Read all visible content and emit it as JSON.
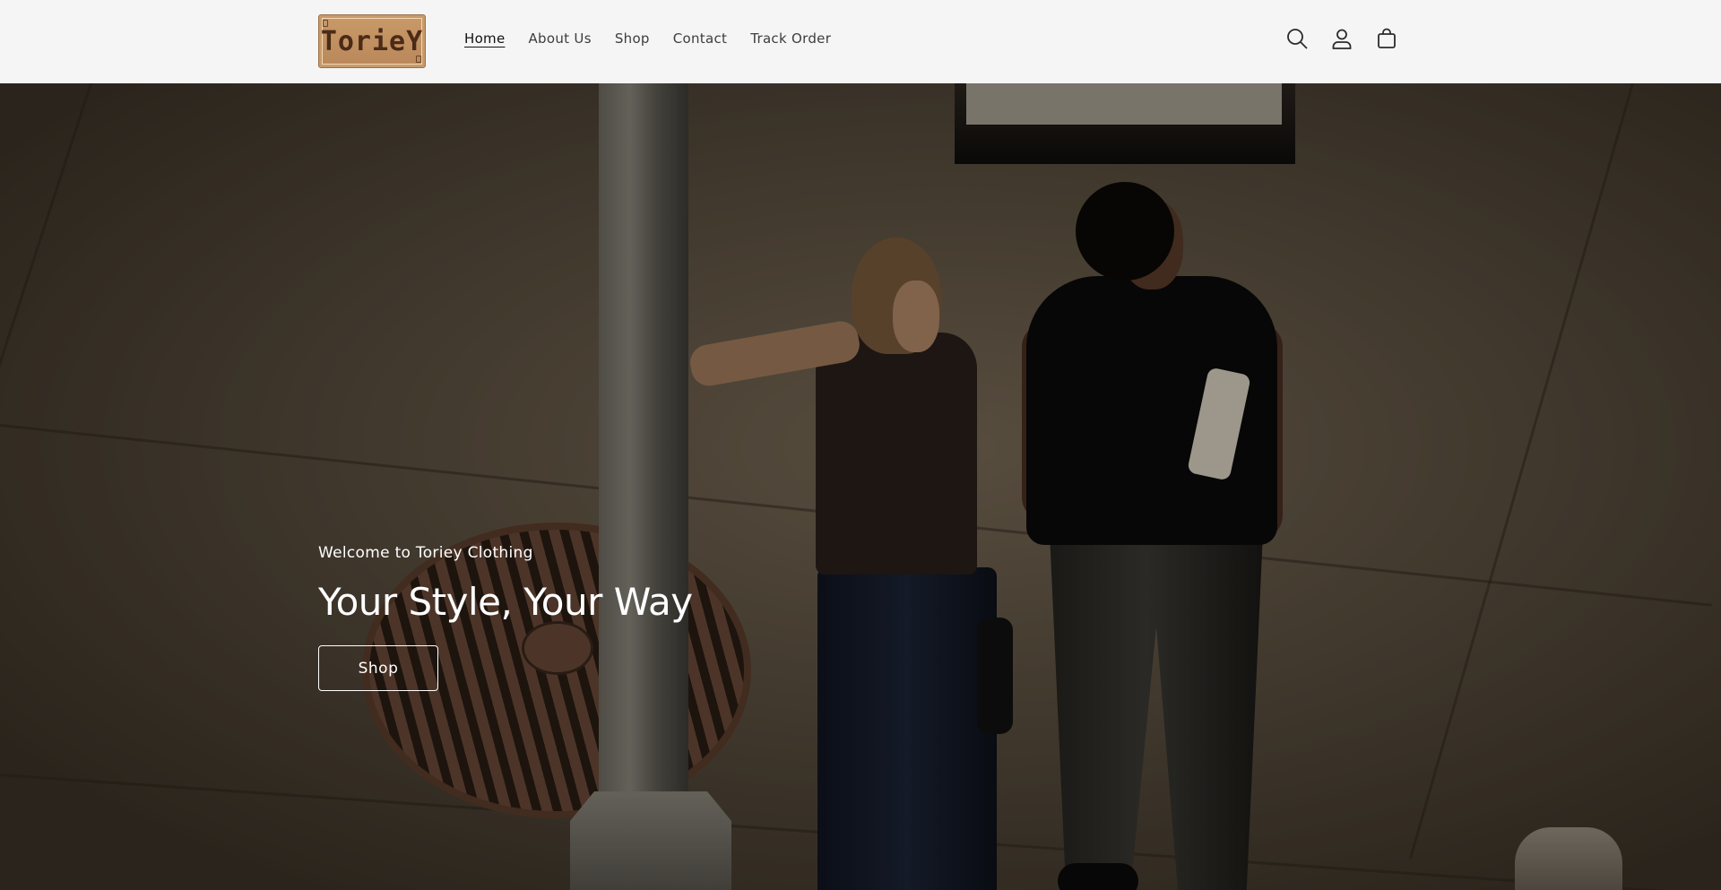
{
  "header": {
    "logo_text": "TorieY",
    "nav": [
      {
        "label": "Home",
        "active": true
      },
      {
        "label": "About Us",
        "active": false
      },
      {
        "label": "Shop",
        "active": false
      },
      {
        "label": "Contact",
        "active": false
      },
      {
        "label": "Track Order",
        "active": false
      }
    ],
    "icons": [
      "search-icon",
      "account-icon",
      "cart-icon"
    ]
  },
  "hero": {
    "subtitle": "Welcome to Toriey Clothing",
    "title": "Your Style, Your Way",
    "button_label": "Shop"
  },
  "colors": {
    "header_bg": "#f5f5f5",
    "nav_text": "#3d3d3d",
    "logo_bg": "#c99a68",
    "logo_text": "#4a2a18",
    "hero_text": "#ffffff"
  }
}
